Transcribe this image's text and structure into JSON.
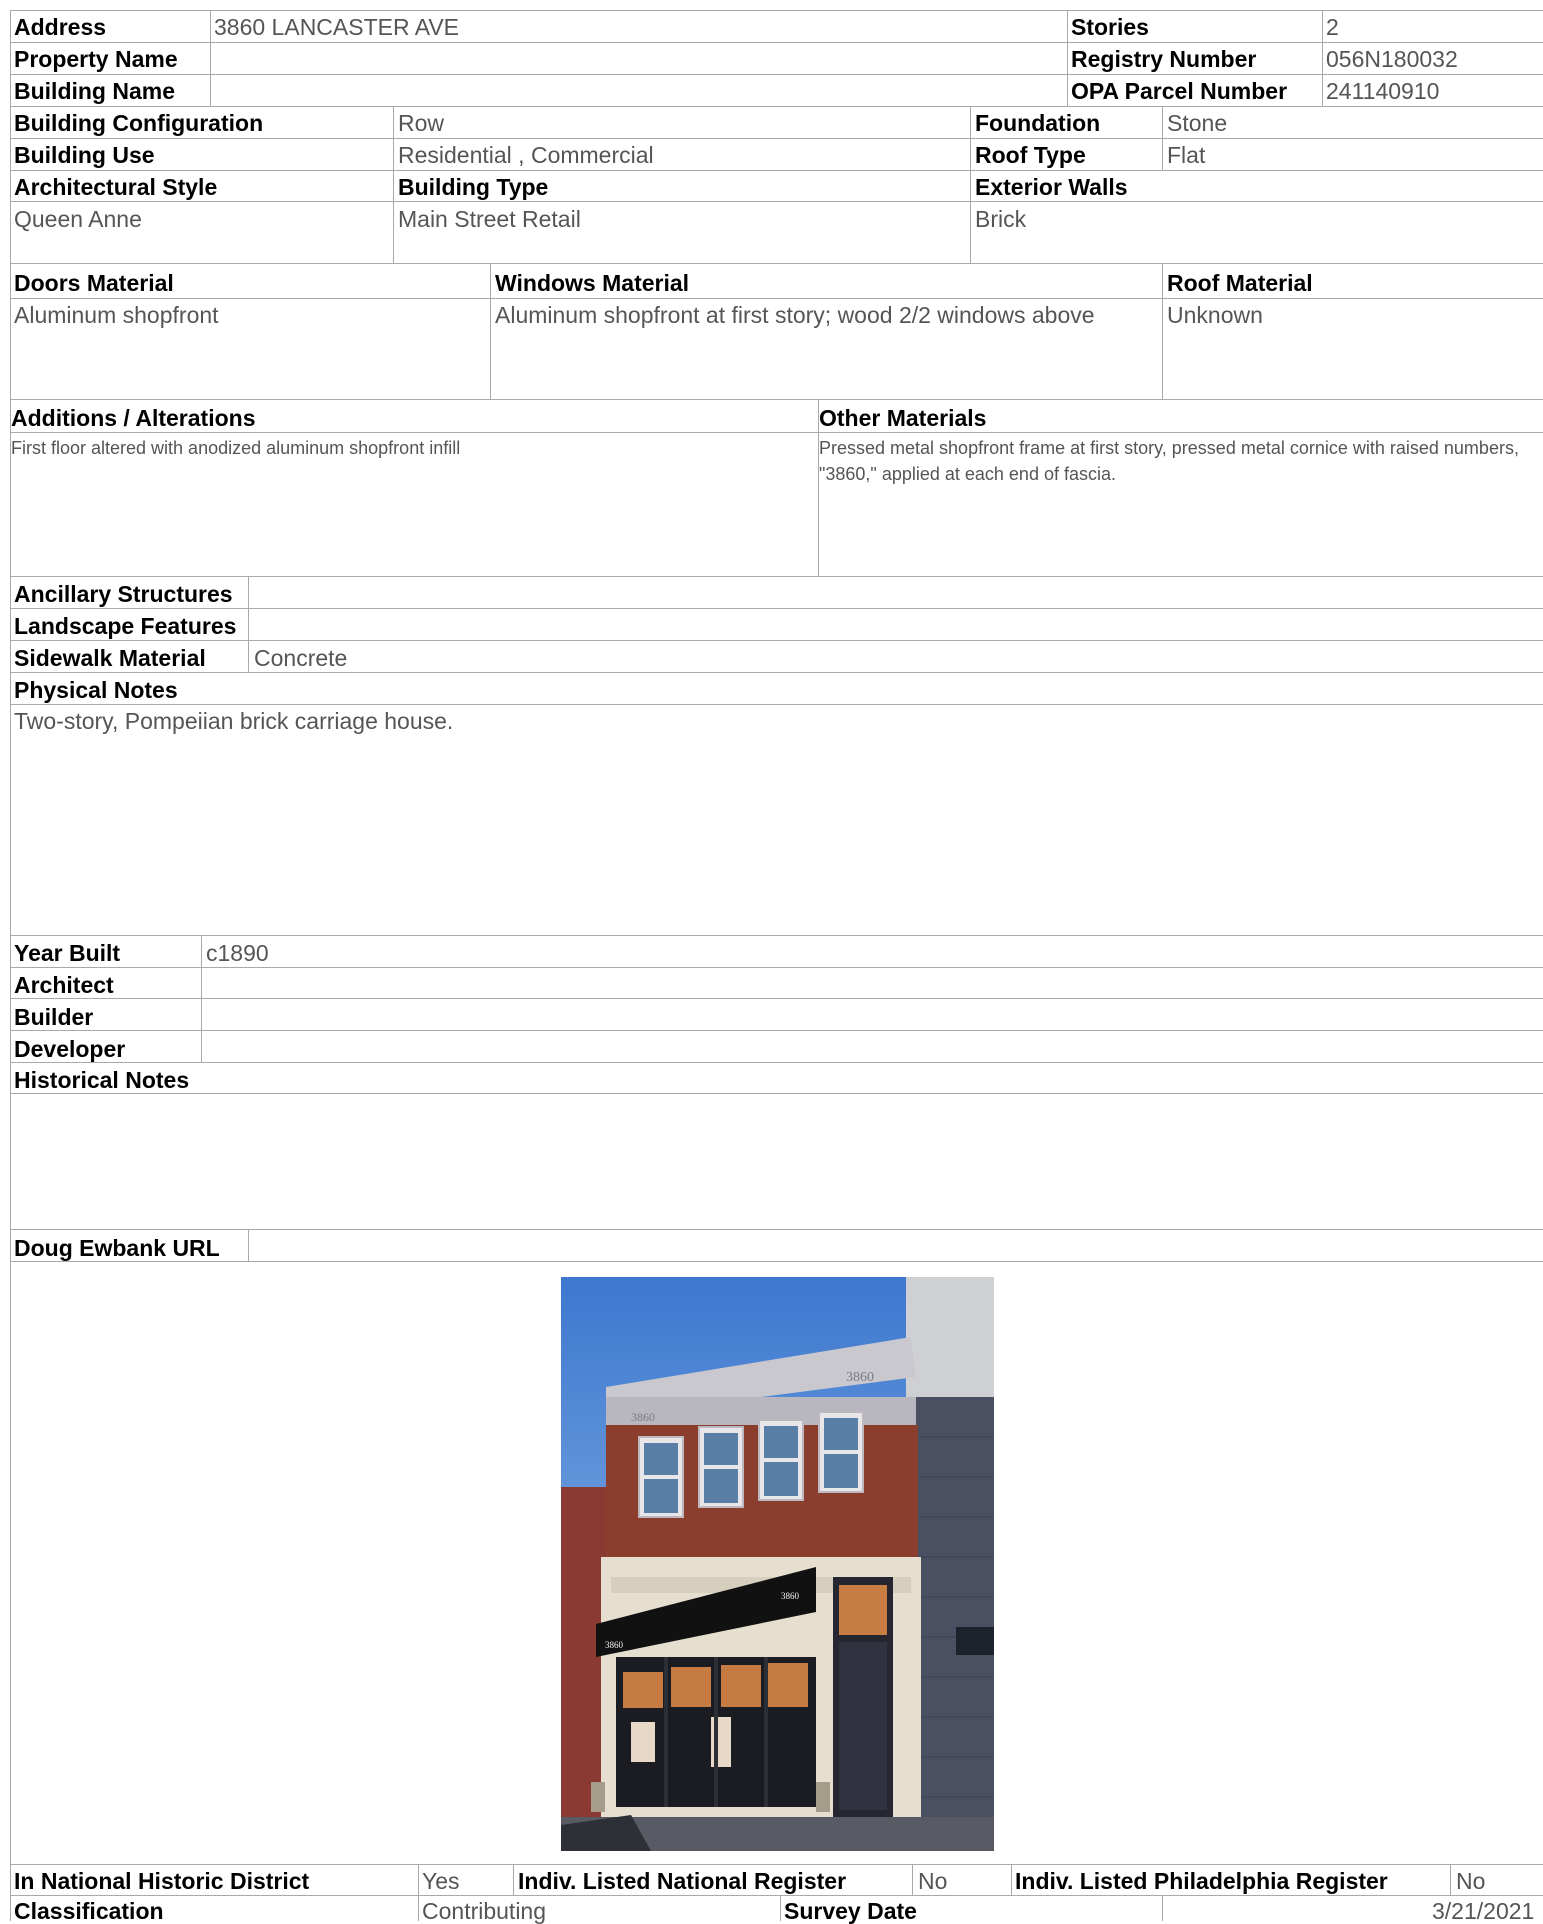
{
  "record": {
    "address_label": "Address",
    "address": "3860 LANCASTER AVE",
    "stories_label": "Stories",
    "stories": "2",
    "property_name_label": "Property Name",
    "property_name": "",
    "registry_label": "Registry Number",
    "registry": "056N180032",
    "building_name_label": "Building Name",
    "building_name": "",
    "opa_label": "OPA Parcel Number",
    "opa": "241140910",
    "config_label": "Building Configuration",
    "config": "Row",
    "foundation_label": "Foundation",
    "foundation": "Stone",
    "use_label": "Building Use",
    "use": "Residential , Commercial",
    "roof_type_label": "Roof Type",
    "roof_type": "Flat",
    "arch_style_label": "Architectural Style",
    "arch_style": "Queen Anne",
    "building_type_label": "Building Type",
    "building_type": "Main Street Retail",
    "ext_walls_label": "Exterior Walls",
    "ext_walls": "Brick",
    "doors_label": "Doors Material",
    "doors": "Aluminum shopfront",
    "windows_label": "Windows Material",
    "windows": "Aluminum shopfront at first story; wood 2/2 windows above",
    "roof_material_label": "Roof Material",
    "roof_material": "Unknown",
    "additions_label": "Additions / Alterations",
    "additions": "First floor altered with anodized aluminum shopfront infill",
    "other_materials_label": "Other Materials",
    "other_materials": "Pressed metal shopfront frame at first story, pressed metal cornice with raised numbers, \"3860,\" applied at each end of fascia.",
    "ancillary_label": "Ancillary Structures",
    "ancillary": "",
    "landscape_label": "Landscape Features",
    "landscape": "",
    "sidewalk_label": "Sidewalk Material",
    "sidewalk": "Concrete",
    "physical_notes_label": "Physical Notes",
    "physical_notes": "Two-story, Pompeiian brick carriage house.",
    "year_label": "Year Built",
    "year": "c1890",
    "architect_label": "Architect",
    "architect": "",
    "builder_label": "Builder",
    "builder": "",
    "developer_label": "Developer",
    "developer": "",
    "historical_label": "Historical Notes",
    "historical": "",
    "url_label": "Doug Ewbank URL",
    "url": "",
    "nhd_label": "In National Historic District",
    "nhd": "Yes",
    "nr_label": "Indiv. Listed National Register",
    "nr": "No",
    "phl_label": "Indiv. Listed Philadelphia Register",
    "phl": "No",
    "class_label": "Classification",
    "class": "Contributing",
    "survey_label": "Survey Date",
    "survey": "3/21/2021"
  },
  "photo": {
    "facade_number_left": "3860",
    "facade_number_right": "3860",
    "awning_number_left": "3860",
    "awning_number_right": "3860"
  },
  "colors": {
    "rule": "#a9a9a9",
    "label": "#000000",
    "value": "#555555"
  }
}
